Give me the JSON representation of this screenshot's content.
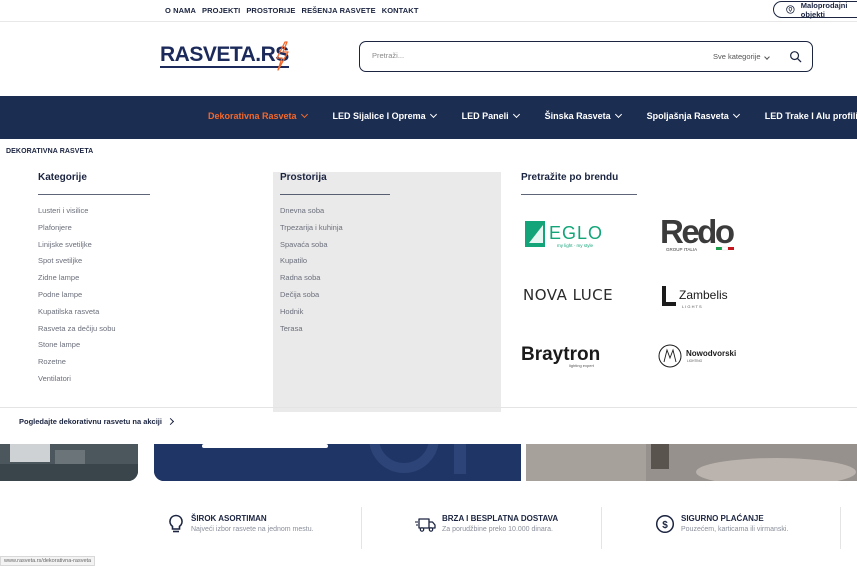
{
  "topnav": [
    "O NAMA",
    "PROJEKTI",
    "PROSTORIJE",
    "REŠENJA RASVETE",
    "KONTAKT"
  ],
  "store_button": "Maloprodajni objekti",
  "logo": "RASVETA.RS",
  "search": {
    "placeholder": "Pretraži...",
    "category": "Sve kategorije"
  },
  "mainnav": [
    {
      "label": "Dekorativna Rasveta",
      "active": true
    },
    {
      "label": "LED Sijalice I Oprema",
      "active": false
    },
    {
      "label": "LED Paneli",
      "active": false
    },
    {
      "label": "Šinska Rasveta",
      "active": false
    },
    {
      "label": "Spoljašnja Rasveta",
      "active": false
    },
    {
      "label": "LED Trake I Alu profili",
      "active": false
    }
  ],
  "mega": {
    "title": "DEKORATIVNA RASVETA",
    "kategorije": {
      "heading": "Kategorije",
      "items": [
        "Lusteri i visilice",
        "Plafonjere",
        "Linijske svetiljke",
        "Spot svetiljke",
        "Zidne lampe",
        "Podne lampe",
        "Kupatilska rasveta",
        "Rasveta za dečiju sobu",
        "Stone lampe",
        "Rozetne",
        "Ventilatori"
      ]
    },
    "prostorija": {
      "heading": "Prostorija",
      "items": [
        "Dnevna soba",
        "Trpezarija i kuhinja",
        "Spavaća soba",
        "Kupatilo",
        "Radna soba",
        "Dečija soba",
        "Hodnik",
        "Terasa"
      ]
    },
    "brendovi": {
      "heading": "Pretražite po brendu",
      "eglo": "EGLO",
      "eglo_tag": "my light · my style",
      "redo": "Redo",
      "redo_tag": "GROUP ITALIA",
      "novaluce": "NOVA LUCE",
      "zambelis": "Zambelis",
      "zambelis_tag": "L I G H T S",
      "braytron": "Braytron",
      "braytron_tag": "lighting expert",
      "nowodvorski": "Nowodvorski",
      "nowodvorski_tag": "LIGHTING"
    },
    "deal_link": "Pogledajte dekorativnu rasvetu na akciji"
  },
  "features": [
    {
      "title": "ŠIROK ASORTIMAN",
      "sub": "Najveći izbor rasvete na jednom mestu."
    },
    {
      "title": "BRZA I BESPLATNA DOSTAVA",
      "sub": "Za porudžbine preko 10.000 dinara."
    },
    {
      "title": "SIGURNO PLAĆANJE",
      "sub": "Pouzećem, karticama ili virmanski."
    }
  ],
  "status_url": "www.rasveta.rs/dekorativna-rasveta",
  "colors": {
    "navy": "#1c2d52",
    "accent": "#f2682c",
    "eglo_green": "#13a579",
    "redo_red": "#c4161c"
  }
}
